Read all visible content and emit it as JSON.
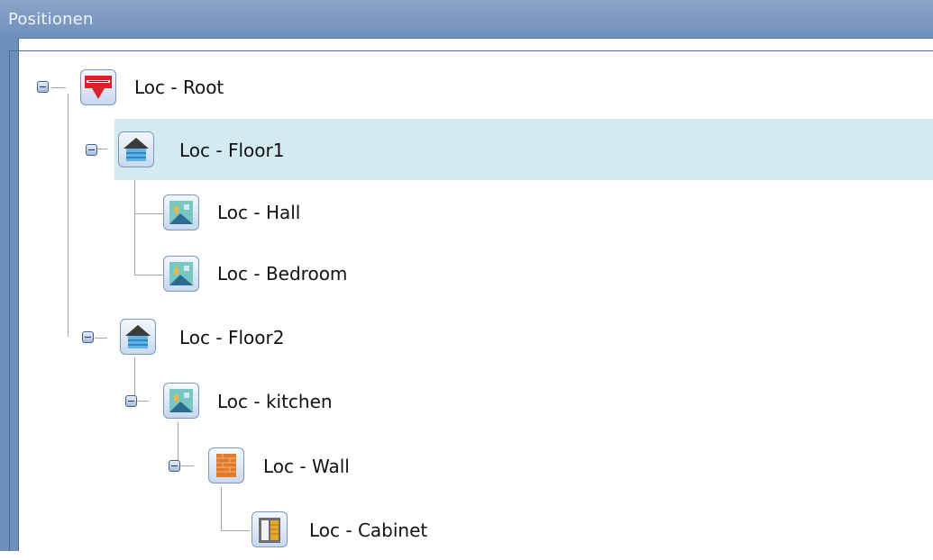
{
  "panel": {
    "title": "Positionen"
  },
  "tree": {
    "nodes": [
      {
        "label": "Loc - Root",
        "icon": "company-logo-icon",
        "level": 0,
        "expanded": true,
        "selected": false
      },
      {
        "label": "Loc - Floor1",
        "icon": "floor-icon",
        "level": 1,
        "expanded": true,
        "selected": true
      },
      {
        "label": "Loc - Hall",
        "icon": "room-icon",
        "level": 2,
        "expanded": false,
        "selected": false
      },
      {
        "label": "Loc - Bedroom",
        "icon": "room-icon",
        "level": 2,
        "expanded": false,
        "selected": false
      },
      {
        "label": "Loc - Floor2",
        "icon": "floor-icon",
        "level": 1,
        "expanded": true,
        "selected": false
      },
      {
        "label": "Loc - kitchen",
        "icon": "room-icon",
        "level": 2,
        "expanded": true,
        "selected": false
      },
      {
        "label": "Loc - Wall",
        "icon": "wall-icon",
        "level": 3,
        "expanded": true,
        "selected": false
      },
      {
        "label": "Loc - Cabinet",
        "icon": "cabinet-icon",
        "level": 4,
        "expanded": false,
        "selected": false
      }
    ]
  },
  "colors": {
    "titlebar": "#7a98c2",
    "selection": "#d3eaf1",
    "frame": "#6f8fbb"
  }
}
